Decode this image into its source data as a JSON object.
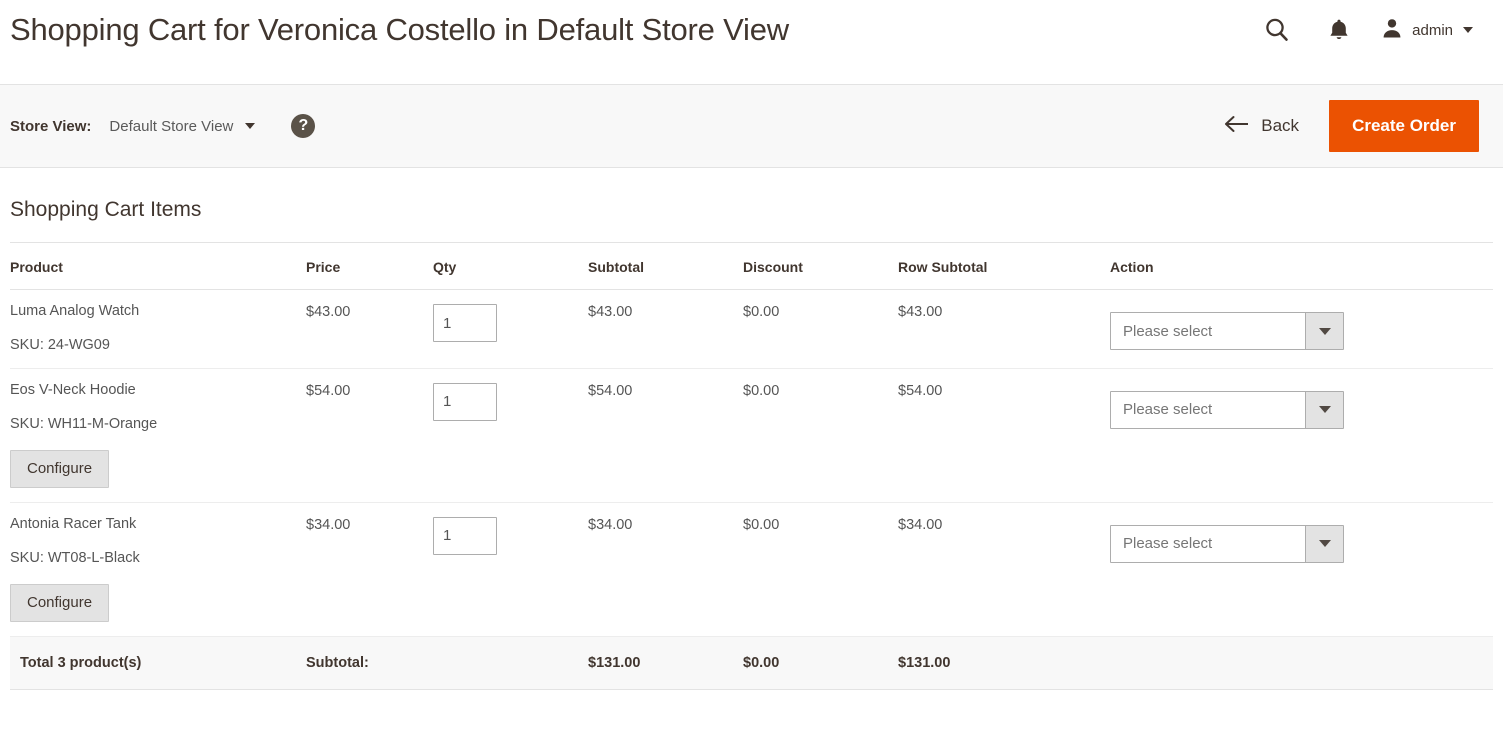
{
  "header": {
    "title": "Shopping Cart for Veronica Costello in Default Store View",
    "search_icon": "search-icon",
    "notifications_icon": "bell-icon",
    "user_icon": "user-avatar-icon",
    "admin_label": "admin"
  },
  "storeview_bar": {
    "label": "Store View:",
    "value": "Default Store View",
    "help_icon": "?",
    "back_label": "Back",
    "back_icon": "arrow-left-icon",
    "create_order_label": "Create Order"
  },
  "colors": {
    "accent": "#eb5202",
    "bar_bg": "#f8f8f8",
    "border": "#e3e3e3",
    "title_text": "#41362f",
    "help_circle": "#5a5248"
  },
  "section": {
    "title": "Shopping Cart Items"
  },
  "table": {
    "headers": [
      "Product",
      "Price",
      "Qty",
      "Subtotal",
      "Discount",
      "Row Subtotal",
      "Action"
    ],
    "rows": [
      {
        "product": "Luma Analog Watch",
        "sku": "SKU: 24-WG09",
        "configure": null,
        "price": "$43.00",
        "qty": "1",
        "subtotal": "$43.00",
        "discount": "$0.00",
        "row_subtotal": "$43.00",
        "action": "Please select"
      },
      {
        "product": "Eos V-Neck Hoodie",
        "sku": "SKU: WH11-M-Orange",
        "configure": "Configure",
        "price": "$54.00",
        "qty": "1",
        "subtotal": "$54.00",
        "discount": "$0.00",
        "row_subtotal": "$54.00",
        "action": "Please select"
      },
      {
        "product": "Antonia Racer Tank",
        "sku": "SKU: WT08-L-Black",
        "configure": "Configure",
        "price": "$34.00",
        "qty": "1",
        "subtotal": "$34.00",
        "discount": "$0.00",
        "row_subtotal": "$34.00",
        "action": "Please select"
      }
    ],
    "totals": {
      "count_label": "Total 3 product(s)",
      "subtotal_label": "Subtotal:",
      "subtotal": "$131.00",
      "discount": "$0.00",
      "row_subtotal": "$131.00"
    }
  }
}
